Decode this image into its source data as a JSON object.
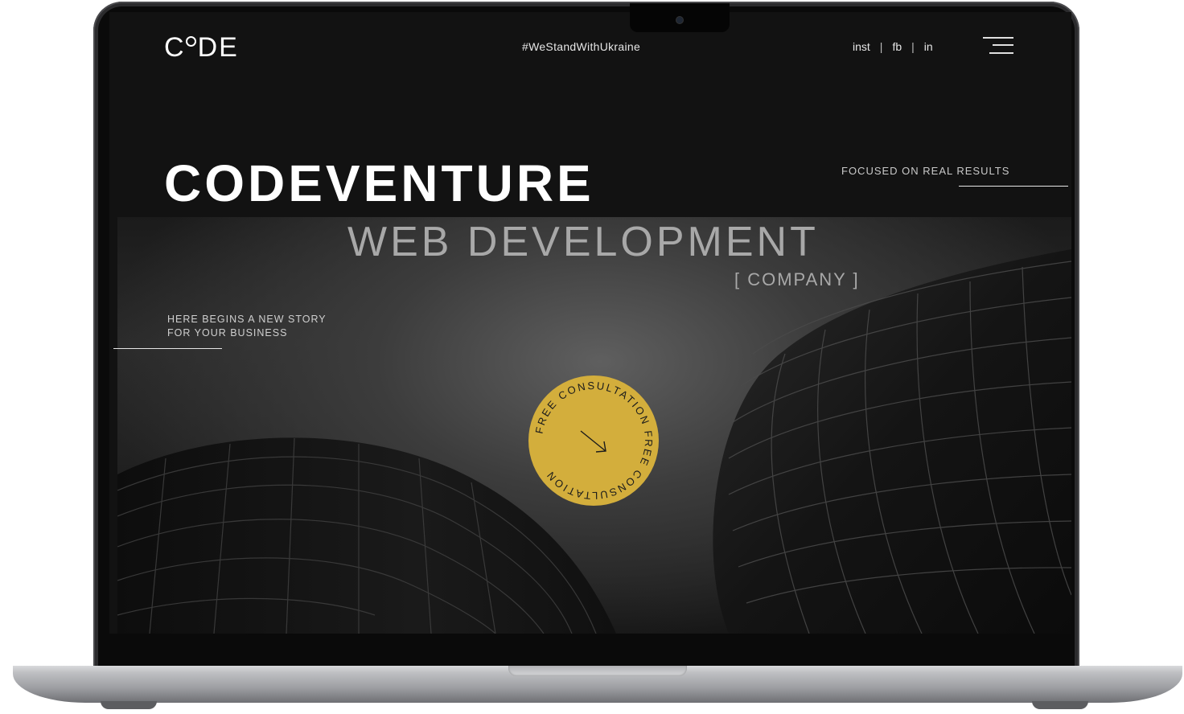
{
  "header": {
    "logo": {
      "c": "C",
      "rest": "DE"
    },
    "hashtag": "#WeStandWithUkraine",
    "social": [
      {
        "label": "inst"
      },
      {
        "label": "fb"
      },
      {
        "label": "in"
      }
    ],
    "separator": "|",
    "menu_icon": "hamburger-menu-icon"
  },
  "hero": {
    "title": "CODEVENTURE",
    "subtitle": "WEB DEVELOPMENT",
    "tag": "[ COMPANY ]",
    "focused": "FOCUSED ON REAL RESULTS",
    "story_line1": "HERE BEGINS A NEW STORY",
    "story_line2": "FOR YOUR BUSINESS"
  },
  "cta": {
    "ring_text": "FREE CONSULTATION FREE CONSULTATION",
    "icon": "arrow-down-right-icon",
    "color": "#d3ae3c"
  },
  "colors": {
    "background": "#121212",
    "text": "#ffffff",
    "muted": "#a8a8a8",
    "accent": "#d3ae3c"
  }
}
